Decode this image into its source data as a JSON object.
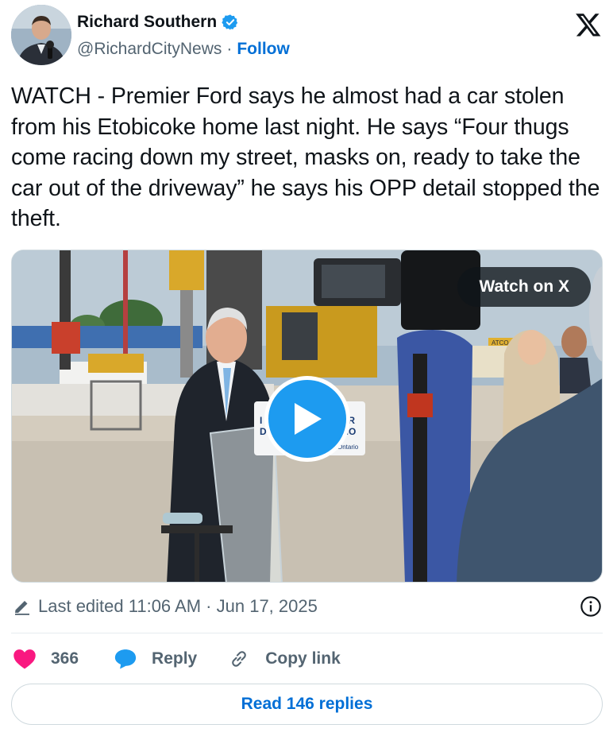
{
  "author": {
    "name": "Richard Southern",
    "handle": "@RichardCityNews",
    "separator": "·",
    "follow_label": "Follow"
  },
  "tweet": {
    "text": "WATCH - Premier Ford says he almost had a car stolen from his Etobicoke home last night. He says “Four thugs come racing down my street, masks on, ready to take the car out of the driveway” he says his OPP detail stopped the theft."
  },
  "media": {
    "watch_label": "Watch on X",
    "podium_text_left": "I\nD",
    "podium_text_right": "IER\nRIO",
    "podium_logo": "Ontario",
    "sign_text": "ATCO"
  },
  "meta": {
    "edited_text": "Last edited 11:06 AM · Jun 17, 2025"
  },
  "actions": {
    "likes": "366",
    "reply_label": "Reply",
    "copy_link_label": "Copy link"
  },
  "footer": {
    "read_replies_label": "Read 146 replies"
  },
  "colors": {
    "accent": "#1d9bf0",
    "link": "#006fd6",
    "like": "#f91880",
    "text": "#0f1419",
    "muted": "#536471"
  },
  "icons": [
    "verified-badge-icon",
    "x-logo-icon",
    "play-icon",
    "pencil-icon",
    "info-icon",
    "heart-icon",
    "reply-bubble-icon",
    "link-icon"
  ]
}
